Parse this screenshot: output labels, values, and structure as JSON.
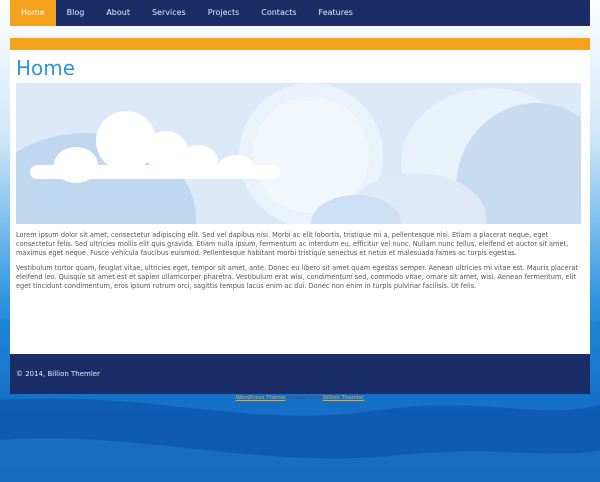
{
  "nav": {
    "items": [
      "Home",
      "Blog",
      "About",
      "Services",
      "Projects",
      "Contacts",
      "Features"
    ],
    "active": "Home"
  },
  "page": {
    "title": "Home",
    "paragraph1": "Lorem ipsum dolor sit amet, consectetur adipiscing elit. Sed vel dapibus nisi. Morbi ac elit lobortis, tristique mi a, pellentesque nisi. Etiam a placerat neque, eget consectetur felis. Sed ultricies mollis elit quis gravida. Etiam nulla ipsum, fermentum ac interdum eu, efficitur vel nunc. Nullam nunc tellus, eleifend et auctor sit amet, maximus eget neque. Fusce vehicula faucibus euismod. Pellentesque habitant morbi tristique senectus et netus et malesuada fames ac turpis egestas.",
    "paragraph2": "Vestibulum tortor quam, feugiat vitae, ultricies eget, tempor sit amet, ante. Donec eu libero sit amet quam egestas semper. Aenean ultricies mi vitae est. Mauris placerat eleifend leo. Quisque sit amet est et sapien ullamcorper pharetra. Vestibulum erat wisi, condimentum sed, commodo vitae, ornare sit amet, wisi. Aenean fermentum, elit eget tincidunt condimentum, eros ipsum rutrum orci, sagittis tempus lacus enim ac dui. Donec non enim in turpis pulvinar facilisis. Ut felis."
  },
  "footer": {
    "copyright": "© 2014, Billion Themler"
  },
  "credit": {
    "link1": "WordPress Theme",
    "middle": "created with",
    "link2": "Billion Themler"
  },
  "colors": {
    "nav_bg": "#1b2d66",
    "accent": "#f4a11c",
    "title": "#2e97d8"
  }
}
